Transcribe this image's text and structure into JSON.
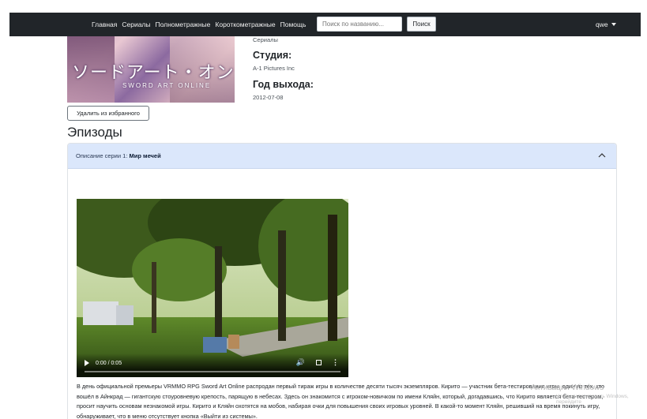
{
  "nav": {
    "links": [
      "Главная",
      "Сериалы",
      "Полнометражные",
      "Короткометражные",
      "Помощь"
    ],
    "search_placeholder": "Поиск по названию...",
    "search_button": "Поиск",
    "user": "qwe"
  },
  "poster": {
    "title_text": "ソードアート・オンライン",
    "subtitle_text": "SWORD ART ONLINE"
  },
  "info": {
    "type_value": "Сериалы",
    "studio_label": "Студия:",
    "studio_value": "A-1 Pictures Inc",
    "year_label": "Год выхода:",
    "year_value": "2012-07-08"
  },
  "remove_favorite_label": "Удалить из избранного",
  "episodes_title": "Эпизоды",
  "episode": {
    "label_prefix": "Описание серии 1: ",
    "name": "Мир мечей",
    "video": {
      "time": "0:00 / 0:05",
      "progress": 0
    },
    "description": "В день официальной премьеры VRMMO RPG Sword Art Online распродан первый тираж игры в количестве десяти тысяч экземпляров. Кирито — участник бета-тестирования игры, один из тех, кто вошёл в Айнкрад — гигантскую стоуровневую крепость, парящую в небесах. Здесь он знакомится с игроком-новичком по имени Кляйн, который, догадавшись, что Кирито является бета-тестером, просит научить основам незнакомой игры. Кирито и Кляйн охотятся на мобов, набирая очки для повышения своих игровых уровней. В какой-то момент Кляйн, решивший на время покинуть игру, обнаруживает, что в меню отсутствует кнопка «Выйти из системы»."
  },
  "watermark": {
    "title": "Активация Windows",
    "subtitle": "Чтобы активировать Windows, перейдите"
  },
  "colors": {
    "navbar": "#212529",
    "accordion_header": "#dbe7fb"
  }
}
